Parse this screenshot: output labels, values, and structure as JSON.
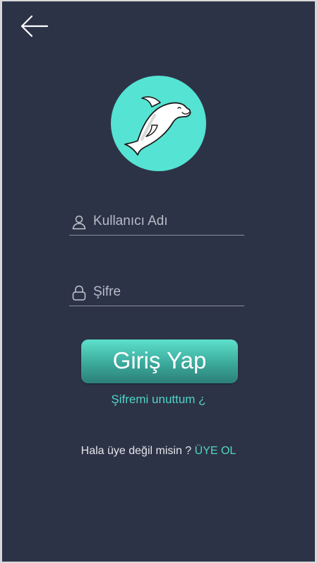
{
  "nav": {
    "back_icon": "arrow-left-icon"
  },
  "logo": {
    "icon": "dolphin-icon",
    "circle_color": "#55e3d3"
  },
  "form": {
    "username": {
      "placeholder": "Kullanıcı Adı",
      "value": "",
      "icon": "user-icon"
    },
    "password": {
      "placeholder": "Şifre",
      "value": "",
      "icon": "lock-icon"
    },
    "login_label": "Giriş Yap",
    "forgot_label": "Şifremi unuttum ¿"
  },
  "signup": {
    "prompt": "Hala üye değil misin ?",
    "link_label": "ÜYE OL"
  },
  "colors": {
    "background": "#2d3347",
    "accent": "#4fd4c4",
    "button_top": "#5ee0cd",
    "button_bottom": "#2d7f79"
  }
}
